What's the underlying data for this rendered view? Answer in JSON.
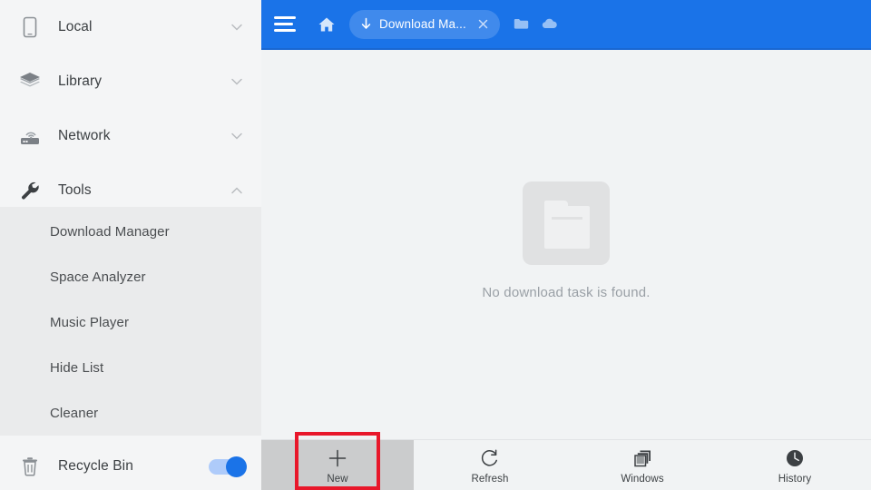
{
  "sidebar": {
    "items": [
      {
        "label": "Local",
        "icon": "phone-icon",
        "chevron": "chevron-down-icon"
      },
      {
        "label": "Library",
        "icon": "layers-icon",
        "chevron": "chevron-down-icon"
      },
      {
        "label": "Network",
        "icon": "router-icon",
        "chevron": "chevron-down-icon"
      },
      {
        "label": "Tools",
        "icon": "wrench-icon",
        "chevron": "chevron-up-icon"
      }
    ],
    "submenu": [
      {
        "label": "Download Manager"
      },
      {
        "label": "Space Analyzer"
      },
      {
        "label": "Music Player"
      },
      {
        "label": "Hide List"
      },
      {
        "label": "Cleaner"
      }
    ],
    "recycle_bin": {
      "label": "Recycle Bin",
      "icon": "trash-icon",
      "toggle_state": "on",
      "toggle_color": "#1a73e8"
    }
  },
  "header": {
    "background_color": "#1a73e8",
    "menu_icon": "hamburger-icon",
    "home_icon": "home-icon",
    "tab": {
      "title": "Download Ma...",
      "icon": "download-arrow-icon",
      "close_icon": "close-icon"
    },
    "folder_icon": "folder-icon",
    "cloud_icon": "cloud-icon"
  },
  "content": {
    "empty_state": {
      "icon": "empty-folder-icon",
      "message": "No download task is found."
    }
  },
  "bottombar": {
    "buttons": [
      {
        "label": "New",
        "icon": "plus-icon",
        "state": "pressed"
      },
      {
        "label": "Refresh",
        "icon": "refresh-icon",
        "state": "normal"
      },
      {
        "label": "Windows",
        "icon": "windows-stack-icon",
        "state": "normal"
      },
      {
        "label": "History",
        "icon": "clock-icon",
        "state": "normal"
      }
    ]
  },
  "annotation": {
    "highlight_color": "#e8172a",
    "target": "New"
  }
}
